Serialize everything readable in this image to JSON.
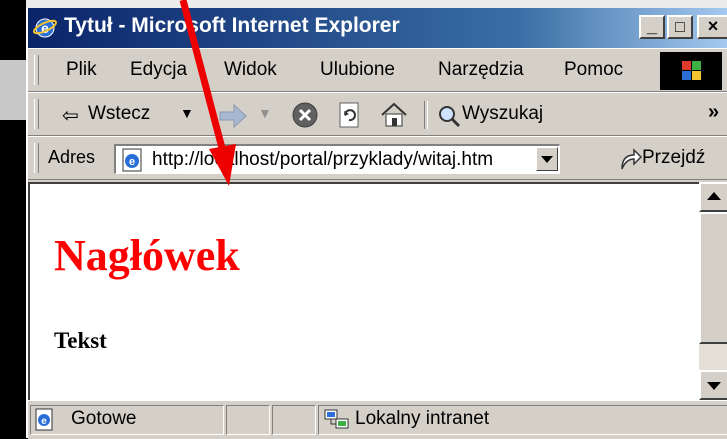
{
  "window": {
    "title": "Tytuł - Microsoft Internet Explorer",
    "controls": {
      "minimize": "_",
      "maximize": "□",
      "close": "×"
    }
  },
  "menu": {
    "items": [
      "Plik",
      "Edycja",
      "Widok",
      "Ulubione",
      "Narzędzia",
      "Pomoc"
    ]
  },
  "toolbar": {
    "back_label": "Wstecz",
    "search_label": "Wyszukaj",
    "overflow": "»"
  },
  "address": {
    "label": "Adres",
    "url": "http://localhost/portal/przyklady/witaj.htm",
    "go_label": "Przejdź"
  },
  "page": {
    "heading": "Nagłówek",
    "text": "Tekst",
    "heading_color": "#ff0000"
  },
  "status": {
    "text": "Gotowe",
    "zone": "Lokalny intranet"
  },
  "annotation": {
    "color": "#ee0000",
    "icon": "red-arrow-pointing-to-address-bar"
  }
}
